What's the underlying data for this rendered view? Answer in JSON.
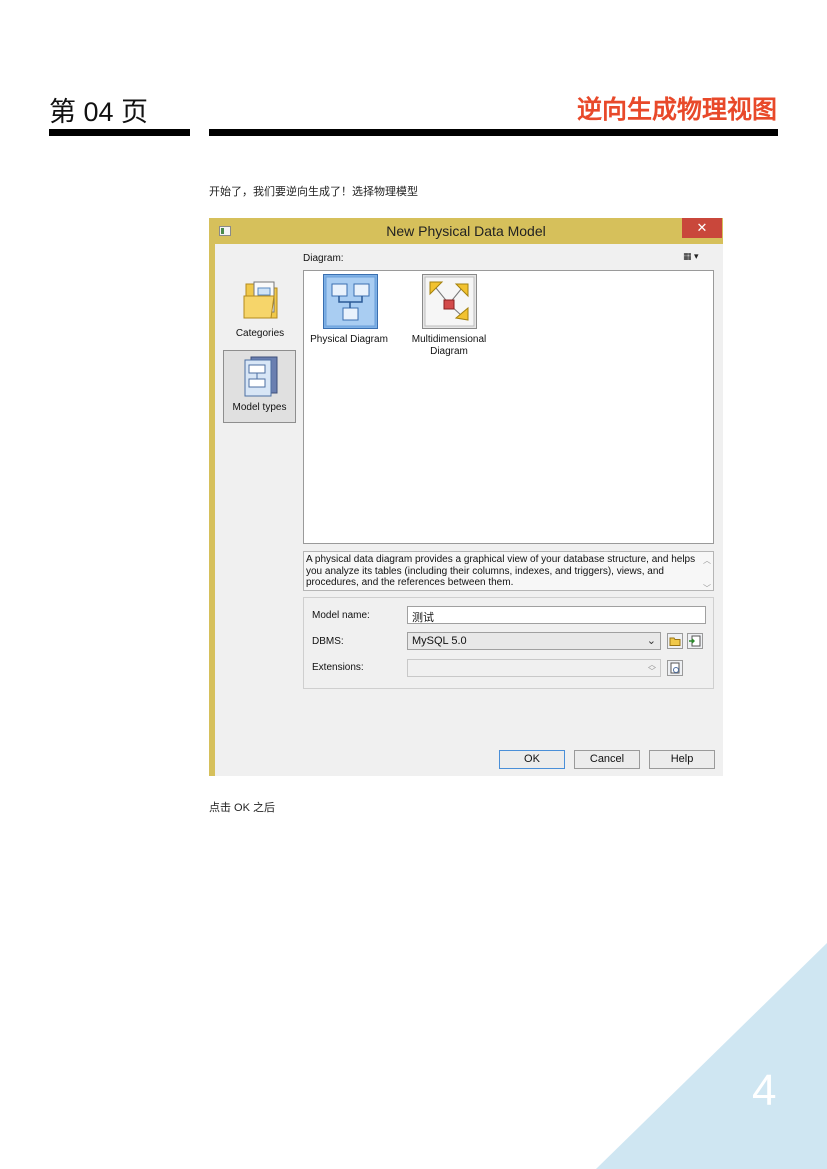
{
  "header": {
    "page_label": "第 04 页",
    "section_title": "逆向生成物理视图"
  },
  "intro_text": "开始了，我们要逆向生成了！选择物理模型",
  "after_text": "点击 OK 之后",
  "page_number": "4",
  "colors": {
    "accent": "#e8492a",
    "corner": "#cfe6f2",
    "dialog_frame": "#d6c05b",
    "close": "#c9473b"
  },
  "dialog": {
    "title": "New Physical Data Model",
    "close_glyph": "✕",
    "sidebar": [
      {
        "label": "Categories",
        "icon": "folder-icon"
      },
      {
        "label": "Model types",
        "icon": "model-types-icon",
        "selected": true
      }
    ],
    "diagram_label": "Diagram:",
    "view_button": "▦ ▾",
    "diagram_types": [
      {
        "label": "Physical Diagram",
        "icon": "physical-diagram-icon",
        "selected": true
      },
      {
        "label_line1": "Multidimensional",
        "label_line2": "Diagram",
        "icon": "multidimensional-diagram-icon"
      }
    ],
    "description": "A physical data diagram provides a graphical view of your database structure, and helps you analyze its tables (including their columns, indexes, and triggers), views, and procedures, and the references between them.",
    "model_name_label": "Model name:",
    "model_name_value": "测试",
    "dbms_label": "DBMS:",
    "dbms_value": "MySQL 5.0",
    "extensions_label": "Extensions:",
    "extensions_value": "",
    "ok_label": "OK",
    "cancel_label": "Cancel",
    "help_label": "Help"
  }
}
